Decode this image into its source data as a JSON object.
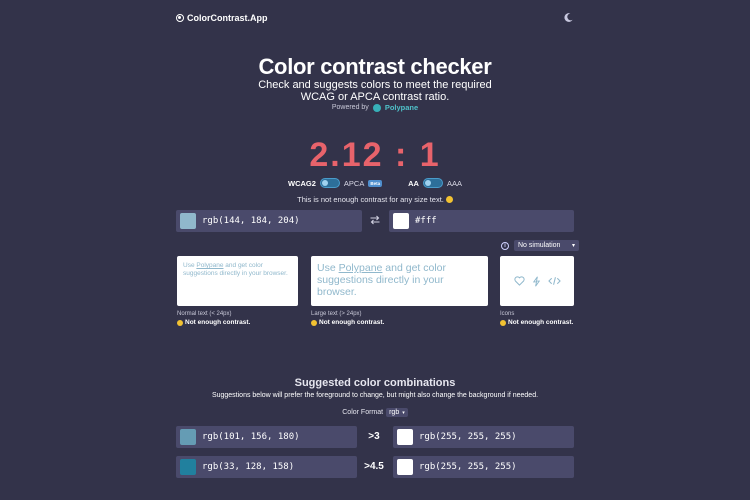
{
  "header": {
    "brand": "ColorContrast.App"
  },
  "hero": {
    "title": "Color contrast checker",
    "subtitle_line1": "Check and suggests colors to meet the required",
    "subtitle_line2": "WCAG or APCA contrast ratio.",
    "powered_by": "Powered by",
    "powered_name": "Polypane"
  },
  "result": {
    "ratio": "2.12 : 1",
    "toggle1_left": "WCAG2",
    "toggle1_right": "APCA",
    "beta": "Beta",
    "toggle2_left": "AA",
    "toggle2_right": "AAA",
    "message": "This is not enough contrast for any size text."
  },
  "foreground": {
    "value": "rgb(144, 184, 204)",
    "color": "#90b8cc"
  },
  "background": {
    "value": "#fff",
    "color": "#ffffff"
  },
  "simulation": {
    "selected": "No simulation"
  },
  "previews": {
    "text_pre": "Use ",
    "link": "Polypane",
    "text_post": " and get color suggestions directly in your browser.",
    "normal_caption": "Normal text (< 24px)",
    "large_caption": "Large text (> 24px)",
    "icons_caption": "Icons",
    "status": "Not enough contrast."
  },
  "suggestions": {
    "title": "Suggested color combinations",
    "subtitle": "Suggestions below will prefer the foreground to change, but might also change the background if needed.",
    "format_label": "Color Format",
    "format_value": "rgb",
    "rows": [
      {
        "fg": "rgb(101, 156, 180)",
        "fg_color": "#659cb4",
        "ratio": ">3",
        "bg": "rgb(255, 255, 255)",
        "bg_color": "#ffffff"
      },
      {
        "fg": "rgb(33, 128, 158)",
        "fg_color": "#21809e",
        "ratio": ">4.5",
        "bg": "rgb(255, 255, 255)",
        "bg_color": "#ffffff"
      }
    ]
  },
  "colors": {
    "bg": "#33334a",
    "panel": "#4a4a6b",
    "ratio_fail": "#e8636b",
    "accent": "#4fc1c9"
  }
}
